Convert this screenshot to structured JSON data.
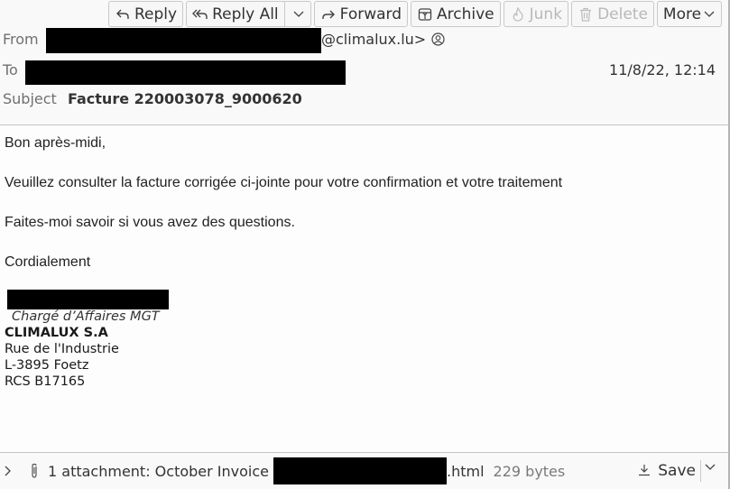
{
  "toolbar": {
    "reply": "Reply",
    "reply_all": "Reply All",
    "forward": "Forward",
    "archive": "Archive",
    "junk": "Junk",
    "delete": "Delete",
    "more": "More"
  },
  "header": {
    "from_label": "From",
    "from_email_suffix": "@climalux.lu>",
    "to_label": "To",
    "subject_label": "Subject",
    "subject": "Facture 220003078_9000620",
    "date": "11/8/22, 12:14"
  },
  "body": {
    "paragraphs": [
      "Bon après-midi,",
      "Veuillez consulter la facture corrigée ci-jointe pour votre confirmation et votre traitement",
      "Faites-moi savoir si vous avez des questions.",
      "Cordialement"
    ],
    "signature": {
      "role": "Chargé d’Affaires MGT",
      "company": "CLIMALUX S.A",
      "address_lines": [
        "Rue de l'Industrie",
        "L-3895 Foetz",
        "RCS B17165"
      ]
    }
  },
  "attachments": {
    "summary_prefix": "1 attachment: October Invoice",
    "extension": ".html",
    "size": "229 bytes",
    "save_label": "Save"
  },
  "colors": {
    "header_bg": "#f9f9f9",
    "body_bg": "#fdfdfd",
    "disabled_text": "#b8b8b8"
  }
}
